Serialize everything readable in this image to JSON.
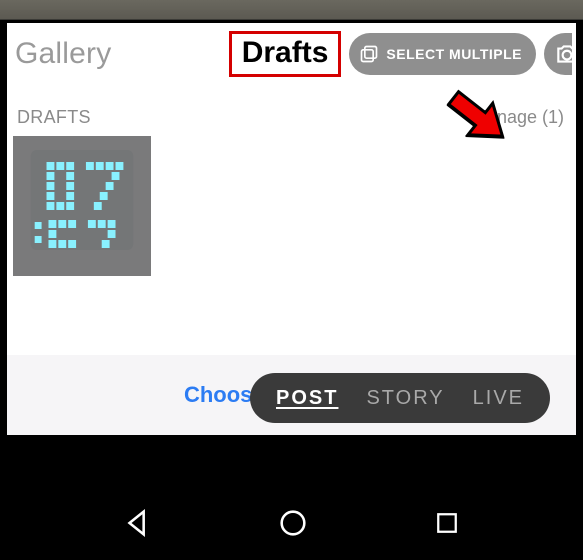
{
  "header": {
    "gallery_label": "Gallery",
    "drafts_tab_label": "Drafts",
    "select_multiple_label": "SELECT MULTIPLE"
  },
  "drafts_section": {
    "heading": "DRAFTS",
    "manage_label": "Manage (1)"
  },
  "choose_link": "Choose from photos",
  "mode_selector": {
    "items": [
      "POST",
      "STORY",
      "LIVE"
    ],
    "active": "POST"
  },
  "icons": {
    "select_multiple": "stack-icon",
    "camera": "camera-icon",
    "nav_back": "back-triangle-icon",
    "nav_home": "circle-icon",
    "nav_recent": "square-icon"
  },
  "colors": {
    "highlight_red": "#d40000",
    "link_blue": "#2c7cf3",
    "pill_gray": "#8f8f8f",
    "mode_pill": "#3a3a3a"
  }
}
